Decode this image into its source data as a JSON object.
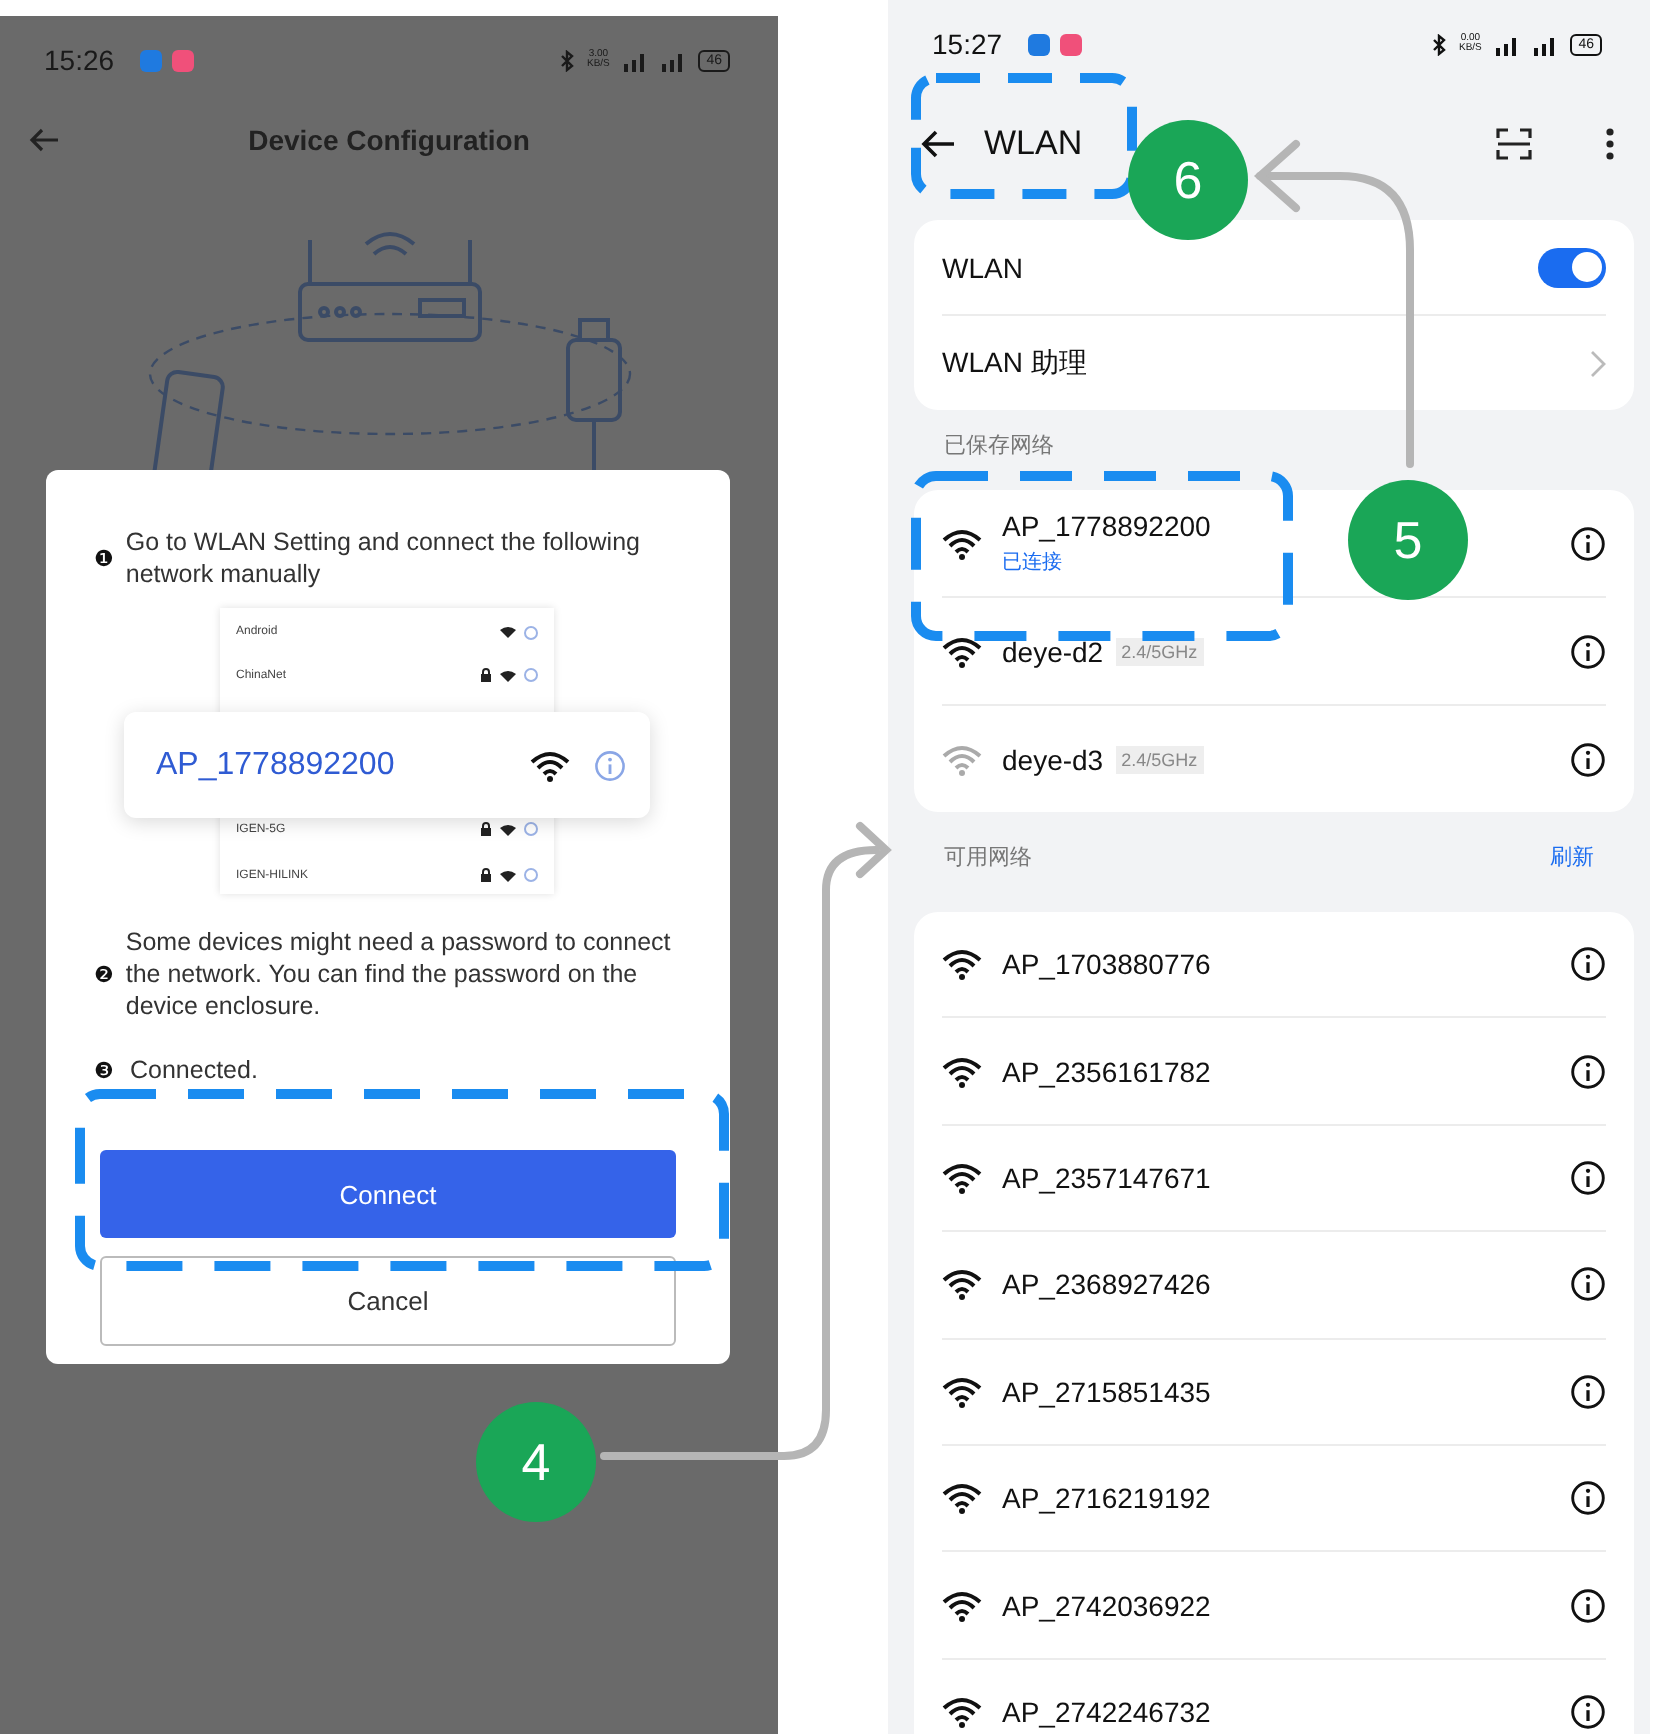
{
  "left_screen": {
    "status_bar": {
      "time": "15:26",
      "net_speed": "3.00 KB/S",
      "battery": "46"
    },
    "header": {
      "title": "Device Configuration"
    },
    "dialog": {
      "steps": [
        {
          "number": "❶",
          "text": "Go to WLAN Setting and connect the following network manually"
        },
        {
          "number": "❷",
          "text": "Some devices might need a password to connect the network. You can find the password on the device enclosure."
        },
        {
          "number": "❸",
          "text": "Connected."
        }
      ],
      "network_preview": {
        "rows": [
          {
            "name": "Android",
            "locked": false
          },
          {
            "name": "ChinaNet",
            "locked": true
          },
          {
            "name": "IGEN-5G",
            "locked": true
          },
          {
            "name": "IGEN-HILINK",
            "locked": true
          }
        ],
        "highlight": "AP_1778892200"
      },
      "buttons": [
        {
          "label": "Connect",
          "kind": "primary"
        },
        {
          "label": "Cancel",
          "kind": "secondary"
        }
      ]
    }
  },
  "right_screen": {
    "status_bar": {
      "time": "15:27",
      "net_speed": "0.00 KB/S",
      "battery": "46"
    },
    "header": {
      "title": "WLAN"
    },
    "settings": [
      {
        "kind": "toggle",
        "label": "WLAN",
        "on": true
      },
      {
        "kind": "link",
        "label": "WLAN 助理"
      }
    ],
    "saved_section": {
      "title": "已保存网络",
      "networks": [
        {
          "name": "AP_1778892200",
          "status": "已连接"
        },
        {
          "name": "deye-d2",
          "band": "2.4/5GHz"
        },
        {
          "name": "deye-d3",
          "band": "2.4/5GHz"
        }
      ]
    },
    "available_section": {
      "title": "可用网络",
      "action": "刷新",
      "networks": [
        {
          "name": "AP_1703880776"
        },
        {
          "name": "AP_2356161782"
        },
        {
          "name": "AP_2357147671"
        },
        {
          "name": "AP_2368927426"
        },
        {
          "name": "AP_2715851435"
        },
        {
          "name": "AP_2716219192"
        },
        {
          "name": "AP_2742036922"
        },
        {
          "name": "AP_2742246732"
        }
      ]
    }
  },
  "annotations": [
    {
      "number": "4"
    },
    {
      "number": "5"
    },
    {
      "number": "6"
    }
  ]
}
